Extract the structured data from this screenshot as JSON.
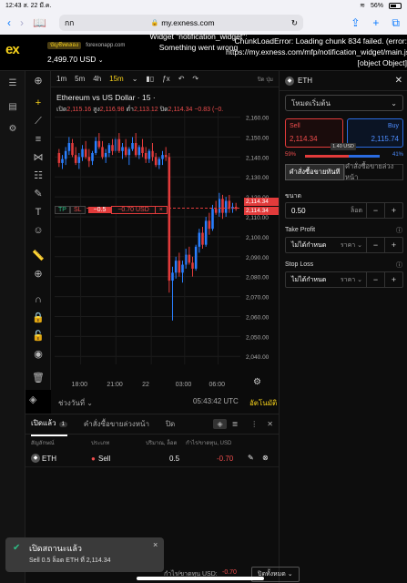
{
  "statusbar": {
    "time": "12:43",
    "date": "ส. 22 มี.ค.",
    "battery": "56%"
  },
  "browser": {
    "aa": "กก",
    "url": "my.exness.com",
    "lock_icon": "lock-icon",
    "reload_icon": "reload-icon"
  },
  "account": {
    "type": "บัญชีทดลอง",
    "server": "forexonapp.com",
    "balance": "2,499.70 USD"
  },
  "errors": {
    "widget": "Widget \"notification_widget\": Something went wrong",
    "chunk": "ChunkLoadError: Loading chunk 834 failed. (error: https://my.exness.com/mfp/notification_widget/main.js) [object Object]"
  },
  "chart_toolbar": {
    "timeframes": [
      "1m",
      "5m",
      "4h",
      "15m"
    ],
    "active": "15m",
    "indicators_label": "ปิด ปุ่ม"
  },
  "chart": {
    "title": "Ethereum vs US Dollar · 15 ·",
    "ohlc": {
      "o_label": "เปิด",
      "o": "2,115.16",
      "h_label": "สูง",
      "h": "2,116.98",
      "l_label": "ต่ำ",
      "l": "2,113.12",
      "c_label": "ปิด",
      "c": "2,114.34",
      "chg": "−0.83 (−0."
    },
    "tp": "TP",
    "sl": "SL",
    "pl_a": "−0.5",
    "pl_b": "−0.70 USD",
    "close_x": "×",
    "price_sell": "2,114.34",
    "price_buy": "2,114.34",
    "date_range_label": "ช่วงวันที่",
    "clock": "05:43:42 UTC",
    "auto": "อัตโนมัติ"
  },
  "chart_data": {
    "type": "candlestick",
    "y_ticks": [
      "2,160.00",
      "2,150.00",
      "2,140.00",
      "2,130.00",
      "2,120.00",
      "2,110.00",
      "2,100.00",
      "2,090.00",
      "2,080.00",
      "2,070.00",
      "2,060.00",
      "2,050.00",
      "2,040.00"
    ],
    "ylim": [
      2036,
      2163
    ],
    "x_ticks": [
      "18:00",
      "21:00",
      "22",
      "03:00",
      "06:00"
    ],
    "candles": [
      [
        2142,
        2144,
        2135,
        2137
      ],
      [
        2137,
        2141,
        2134,
        2139
      ],
      [
        2139,
        2145,
        2136,
        2143
      ],
      [
        2143,
        2150,
        2141,
        2147
      ],
      [
        2147,
        2149,
        2140,
        2141
      ],
      [
        2141,
        2145,
        2136,
        2137
      ],
      [
        2137,
        2142,
        2134,
        2140
      ],
      [
        2140,
        2146,
        2138,
        2144
      ],
      [
        2144,
        2148,
        2139,
        2140
      ],
      [
        2140,
        2144,
        2135,
        2138
      ],
      [
        2138,
        2143,
        2136,
        2142
      ],
      [
        2142,
        2150,
        2141,
        2148
      ],
      [
        2148,
        2152,
        2144,
        2145
      ],
      [
        2145,
        2148,
        2139,
        2140
      ],
      [
        2140,
        2144,
        2137,
        2142
      ],
      [
        2142,
        2147,
        2140,
        2146
      ],
      [
        2146,
        2149,
        2141,
        2143
      ],
      [
        2143,
        2150,
        2142,
        2149
      ],
      [
        2149,
        2152,
        2142,
        2143
      ],
      [
        2143,
        2147,
        2139,
        2145
      ],
      [
        2145,
        2149,
        2140,
        2141
      ],
      [
        2141,
        2145,
        2136,
        2144
      ],
      [
        2144,
        2150,
        2143,
        2147
      ],
      [
        2147,
        2152,
        2140,
        2141
      ],
      [
        2141,
        2146,
        2139,
        2145
      ],
      [
        2145,
        2149,
        2140,
        2142
      ],
      [
        2142,
        2145,
        2137,
        2139
      ],
      [
        2139,
        2144,
        2137,
        2143
      ],
      [
        2143,
        2147,
        2138,
        2140
      ],
      [
        2140,
        2142,
        2135,
        2136
      ],
      [
        2136,
        2140,
        2134,
        2139
      ],
      [
        2139,
        2143,
        2136,
        2141
      ],
      [
        2141,
        2145,
        2138,
        2140
      ],
      [
        2140,
        2142,
        2072,
        2078
      ],
      [
        2078,
        2085,
        2058,
        2082
      ],
      [
        2082,
        2090,
        2079,
        2088
      ],
      [
        2088,
        2092,
        2080,
        2082
      ],
      [
        2082,
        2088,
        2077,
        2086
      ],
      [
        2086,
        2094,
        2084,
        2091
      ],
      [
        2091,
        2095,
        2086,
        2087
      ],
      [
        2087,
        2090,
        2080,
        2084
      ],
      [
        2084,
        2096,
        2083,
        2095
      ],
      [
        2095,
        2104,
        2092,
        2102
      ],
      [
        2102,
        2105,
        2094,
        2096
      ],
      [
        2096,
        2110,
        2095,
        2108
      ],
      [
        2108,
        2112,
        2101,
        2104
      ],
      [
        2104,
        2116,
        2103,
        2114
      ],
      [
        2114,
        2118,
        2111,
        2112
      ],
      [
        2112,
        2122,
        2110,
        2119
      ],
      [
        2119,
        2121,
        2109,
        2112
      ],
      [
        2112,
        2120,
        2110,
        2118
      ],
      [
        2118,
        2121,
        2112,
        2114
      ],
      [
        2114,
        2117,
        2112,
        2115
      ],
      [
        2115,
        2117,
        2113,
        2114
      ]
    ]
  },
  "order_panel": {
    "symbol": "ETH",
    "mode": "โหมดเริ่มต้น",
    "sell_label": "Sell",
    "sell_price": "2,114.34",
    "buy_label": "Buy",
    "buy_price": "2,115.74",
    "spread": "1.40 USD",
    "sell_pct": "59%",
    "buy_pct": "41%",
    "sell_fraction": 0.59,
    "tab_market": "คำสั่งซื้อขายทันที",
    "tab_pending": "คำสั่งซื้อขายล่วงหน้า",
    "volume_label": "ขนาด",
    "volume": "0.50",
    "volume_unit": "ล็อต",
    "tp_label": "Take Profit",
    "tp_value": "ไม่ได้กำหนด",
    "tp_unit": "ราคา",
    "sl_label": "Stop Loss",
    "sl_value": "ไม่ได้กำหนด",
    "sl_unit": "ราคา",
    "minus": "−",
    "plus": "+"
  },
  "positions": {
    "tab_open": "เปิดแล้ว",
    "open_count": "1",
    "tab_pending": "คำสั่งซื้อขายล่วงหน้า",
    "tab_closed": "ปิด",
    "headers": [
      "สัญลักษณ์",
      "ประเภท",
      "ปริมาณ, ล็อต",
      "กำไร/ขาดทุน, USD"
    ],
    "rows": [
      {
        "symbol": "ETH",
        "type": "Sell",
        "volume": "0.5",
        "pl": "-0.70"
      }
    ]
  },
  "toast": {
    "title": "เปิดสถานะแล้ว",
    "body": "Sell 0.5 ล็อต ETH ที่ 2,114.34",
    "close": "×"
  },
  "footer": {
    "pl_label": "กำไร/ขาดทุน USD:",
    "pl_value": "-0.70",
    "close_all": "ปิดทั้งหมด"
  }
}
